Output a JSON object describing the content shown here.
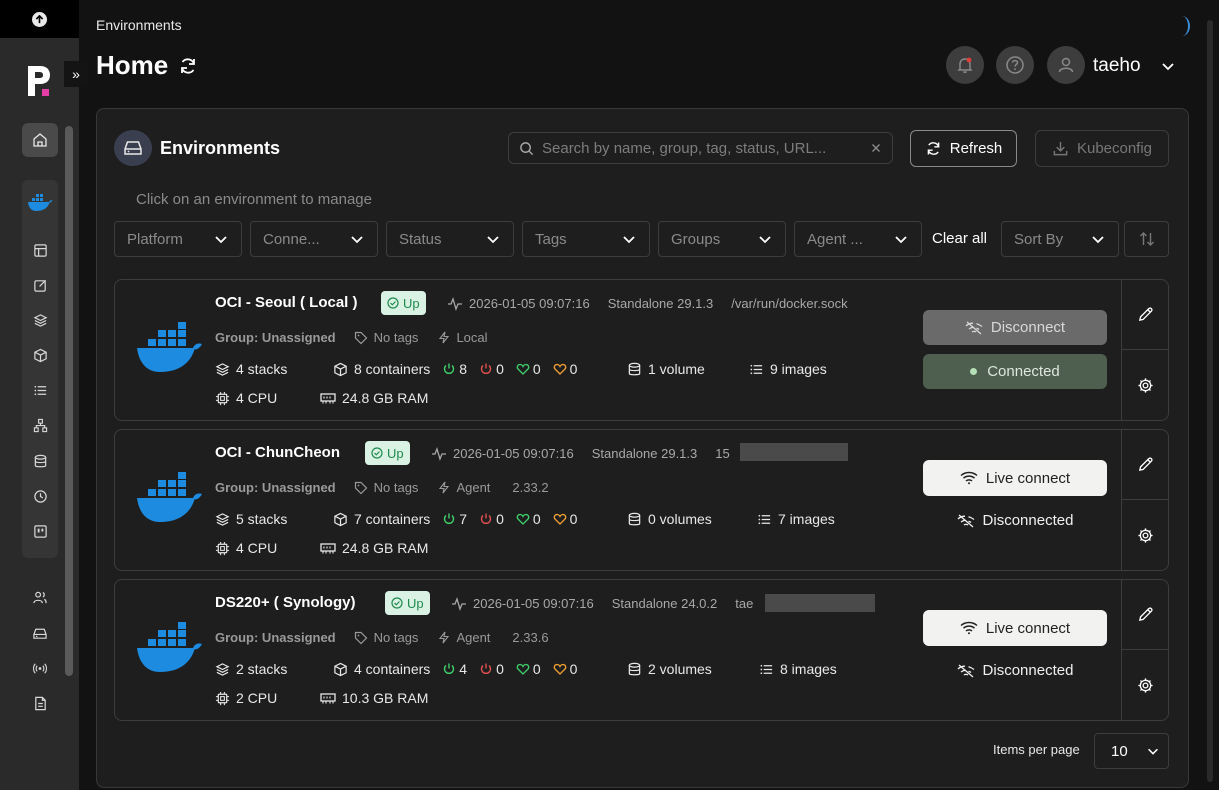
{
  "header": {
    "breadcrumb": "Environments",
    "title": "Home",
    "user": "taeho"
  },
  "panel": {
    "title": "Environments",
    "search_placeholder": "Search by name, group, tag, status, URL...",
    "refresh_label": "Refresh",
    "kubeconfig_label": "Kubeconfig",
    "hint": "Click on an environment to manage",
    "filters": [
      "Platform",
      "Conne...",
      "Status",
      "Tags",
      "Groups",
      "Agent ..."
    ],
    "clear_all": "Clear all",
    "sort_by": "Sort By"
  },
  "environments": [
    {
      "name": "OCI - Seoul ( Local )",
      "status": "Up",
      "timestamp": "2026-01-05 09:07:16",
      "version": "Standalone 29.1.3",
      "url": "/var/run/docker.sock",
      "group": "Group: Unassigned",
      "tags": "No tags",
      "kind": "Local",
      "agent_version": "",
      "stacks": "4 stacks",
      "containers": "8 containers",
      "running": "8",
      "stopped": "0",
      "healthy": "0",
      "unhealthy": "0",
      "volumes": "1 volume",
      "images": "9 images",
      "cpu": "4 CPU",
      "ram": "24.8 GB RAM",
      "action_primary": "Disconnect",
      "action_secondary": "Connected"
    },
    {
      "name": "OCI - ChunCheon",
      "status": "Up",
      "timestamp": "2026-01-05 09:07:16",
      "version": "Standalone 29.1.3",
      "url": "15",
      "group": "Group: Unassigned",
      "tags": "No tags",
      "kind": "Agent",
      "agent_version": "2.33.2",
      "stacks": "5 stacks",
      "containers": "7 containers",
      "running": "7",
      "stopped": "0",
      "healthy": "0",
      "unhealthy": "0",
      "volumes": "0 volumes",
      "images": "7 images",
      "cpu": "4 CPU",
      "ram": "24.8 GB RAM",
      "action_primary": "Live connect",
      "action_secondary": "Disconnected"
    },
    {
      "name": "DS220+ ( Synology)",
      "status": "Up",
      "timestamp": "2026-01-05 09:07:16",
      "version": "Standalone 24.0.2",
      "url": "tae",
      "group": "Group: Unassigned",
      "tags": "No tags",
      "kind": "Agent",
      "agent_version": "2.33.6",
      "stacks": "2 stacks",
      "containers": "4 containers",
      "running": "4",
      "stopped": "0",
      "healthy": "0",
      "unhealthy": "0",
      "volumes": "2 volumes",
      "images": "8 images",
      "cpu": "2 CPU",
      "ram": "10.3 GB RAM",
      "action_primary": "Live connect",
      "action_secondary": "Disconnected"
    }
  ],
  "pagination": {
    "items_per_page_label": "Items per page",
    "items_per_page": "10"
  },
  "colors": {
    "background": "#121212",
    "panel": "#1e1e1e",
    "sidebar": "#2a2a2a",
    "docker_blue": "#1d8be0",
    "up_badge_bg": "#d9f2e4",
    "up_badge_text": "#1f8a4c",
    "running_green": "#3ecf6a",
    "stopped_red": "#e05050",
    "unhealthy_orange": "#f0a030"
  },
  "icons": {
    "sidebar": [
      "home-icon",
      "docker-icon",
      "dashboard-icon",
      "edit-icon",
      "layers-icon",
      "cube-icon",
      "list-icon",
      "network-icon",
      "database-icon",
      "clock-icon",
      "registry-icon",
      "users-icon",
      "environments-icon",
      "radio-icon",
      "file-icon"
    ]
  }
}
